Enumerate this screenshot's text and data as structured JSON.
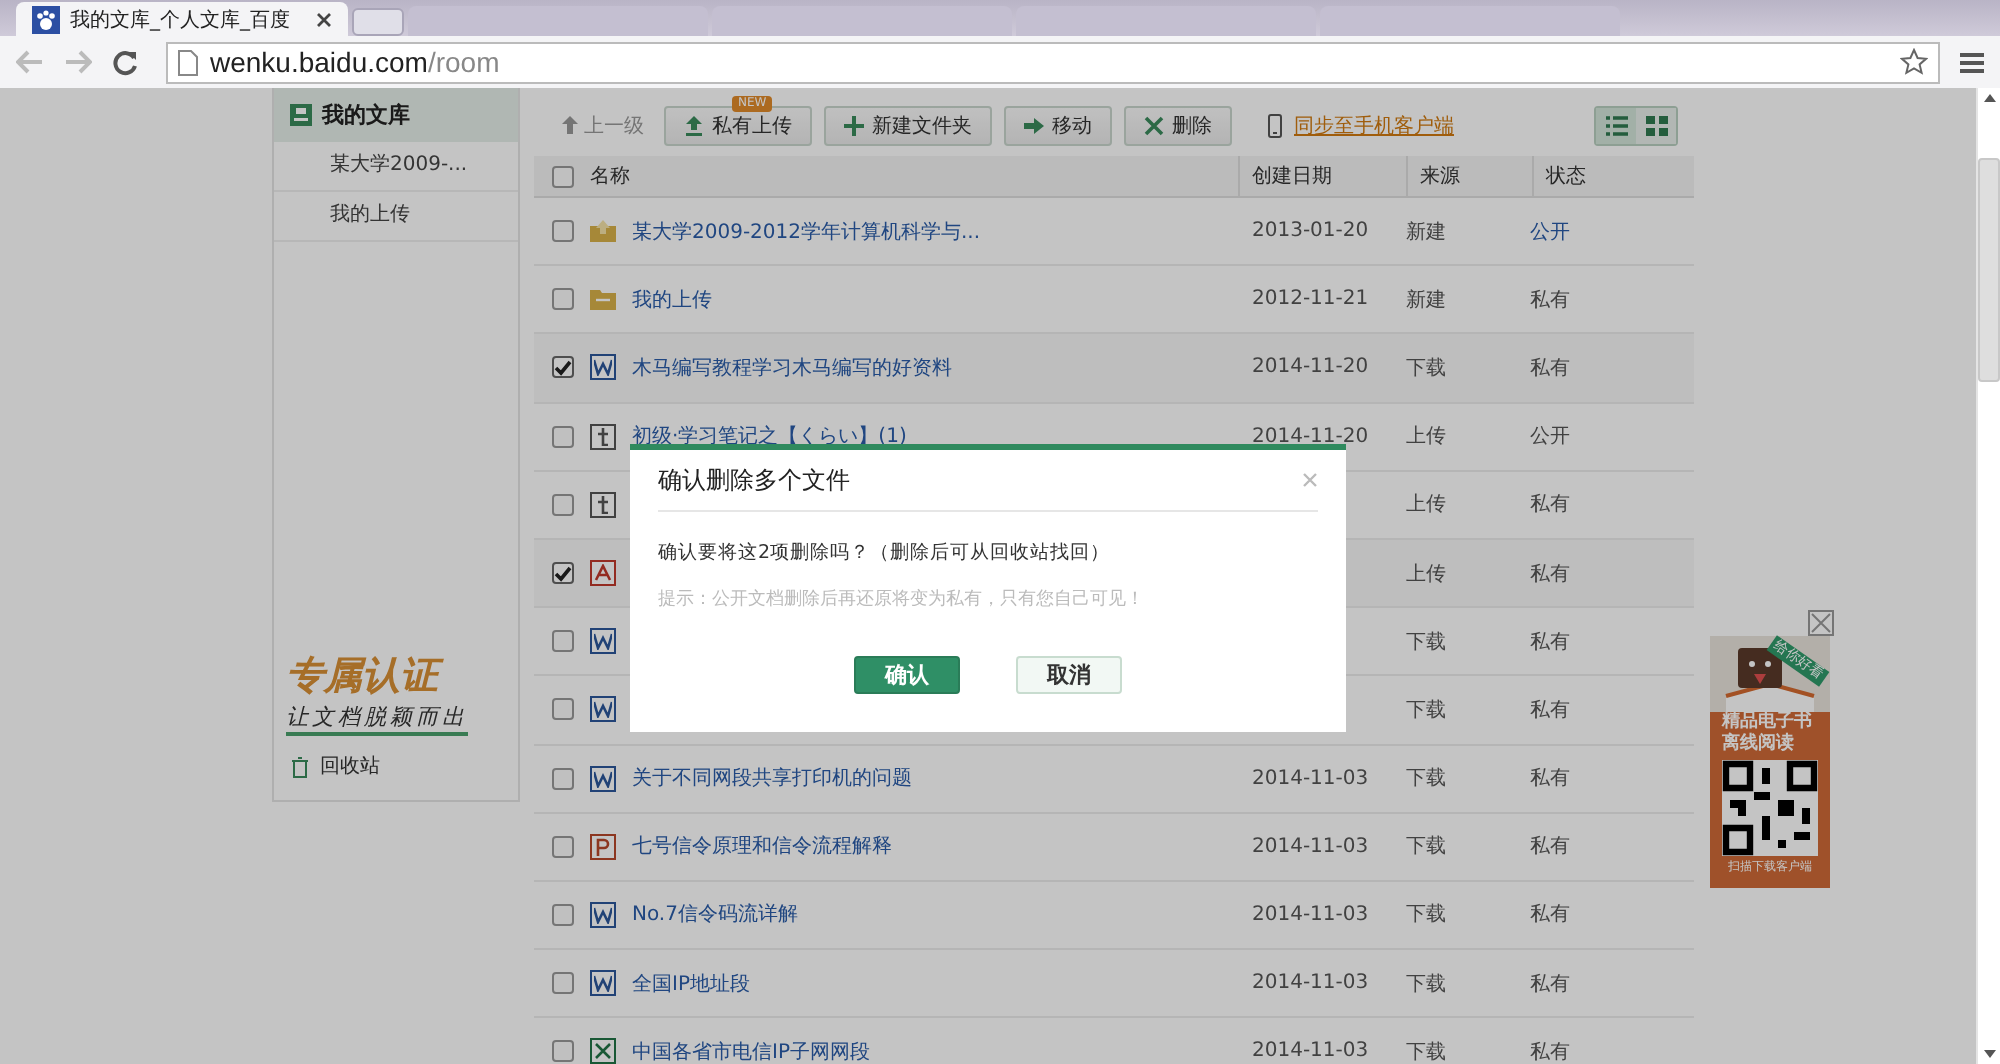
{
  "browser": {
    "tabs": [
      {
        "title": "我的文库_个人文库_百度",
        "selected": true
      },
      {
        "selected": false
      },
      {
        "selected": false
      },
      {
        "selected": false
      },
      {
        "selected": false
      }
    ],
    "url_host": "wenku.baidu.com",
    "url_path": "/room"
  },
  "sidebar": {
    "title": "我的文库",
    "items": [
      {
        "label": "某大学2009-...",
        "selected": false
      },
      {
        "label": "我的上传",
        "selected": false
      }
    ],
    "badge_title": "专属认证",
    "badge_slogan": "让文档脱颖而出",
    "recycle": "回收站"
  },
  "toolbar": {
    "up": {
      "label": "上一级",
      "disabled": true
    },
    "buttons": [
      {
        "kind": "upload",
        "label": "私有上传",
        "badge": "NEW"
      },
      {
        "kind": "new-folder",
        "label": "新建文件夹"
      },
      {
        "kind": "move",
        "label": "移动"
      },
      {
        "kind": "delete",
        "label": "删除"
      }
    ],
    "sync_link": "同步至手机客户端",
    "views": [
      {
        "kind": "list",
        "selected": true
      },
      {
        "kind": "grid",
        "selected": false
      }
    ]
  },
  "table": {
    "columns": [
      "名称",
      "创建日期",
      "来源",
      "状态"
    ],
    "all_checked": false,
    "rows": [
      {
        "kind": "shared-folder",
        "checked": false,
        "name": "某大学2009-2012学年计算机科学与...",
        "date": "2013-01-20",
        "source": "新建",
        "status": "公开",
        "status_link": true
      },
      {
        "kind": "folder",
        "checked": false,
        "name": "我的上传",
        "date": "2012-11-21",
        "source": "新建",
        "status": "私有",
        "status_link": false
      },
      {
        "kind": "word",
        "checked": true,
        "name": "木马编写教程学习木马编写的好资料",
        "date": "2014-11-20",
        "source": "下载",
        "status": "私有",
        "status_link": false
      },
      {
        "kind": "txt",
        "checked": false,
        "name": "初级·学习笔记之【くらい】(1)",
        "date": "2014-11-20",
        "source": "上传",
        "status": "公开",
        "status_link": false
      },
      {
        "kind": "txt",
        "checked": false,
        "source": "上传",
        "status": "私有",
        "status_link": false
      },
      {
        "kind": "pdf",
        "checked": true,
        "source": "上传",
        "status": "私有",
        "status_link": false
      },
      {
        "kind": "word",
        "checked": false,
        "source": "下载",
        "status": "私有",
        "status_link": false
      },
      {
        "kind": "word",
        "checked": false,
        "source": "下载",
        "status": "私有",
        "status_link": false
      },
      {
        "kind": "word",
        "checked": false,
        "name": "关于不同网段共享打印机的问题",
        "date": "2014-11-03",
        "source": "下载",
        "status": "私有",
        "status_link": false
      },
      {
        "kind": "ppt",
        "checked": false,
        "name": "七号信令原理和信令流程解释",
        "date": "2014-11-03",
        "source": "下载",
        "status": "私有",
        "status_link": false
      },
      {
        "kind": "word",
        "checked": false,
        "name": "No.7信令码流详解",
        "date": "2014-11-03",
        "source": "下载",
        "status": "私有",
        "status_link": false
      },
      {
        "kind": "word",
        "checked": false,
        "name": "全国IP地址段",
        "date": "2014-11-03",
        "source": "下载",
        "status": "私有",
        "status_link": false
      },
      {
        "kind": "excel",
        "checked": false,
        "name": "中国各省市电信IP子网网段",
        "date": "2014-11-03",
        "source": "下载",
        "status": "私有",
        "status_link": false
      }
    ]
  },
  "ad": {
    "ribbon": "给你好看",
    "line1": "精品电子书",
    "line2": "离线阅读",
    "footer": "扫描下载客户端"
  },
  "dialog": {
    "title": "确认删除多个文件",
    "message": "确认要将这2项删除吗？（删除后可从回收站找回）",
    "hint": "提示：公开文档删除后再还原将变为私有，只有您自己可见！",
    "confirm": "确认",
    "cancel": "取消"
  }
}
